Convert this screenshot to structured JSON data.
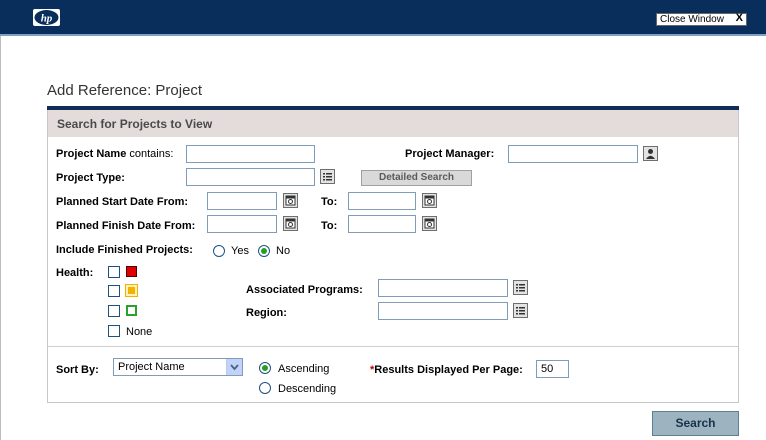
{
  "window": {
    "close_label": "Close Window",
    "close_glyph": "X"
  },
  "page_title": "Add Reference: Project",
  "panel": {
    "title": "Search for Projects to View"
  },
  "form": {
    "project_name": {
      "label_bold": "Project Name",
      "label_rest": " contains:",
      "value": ""
    },
    "project_manager": {
      "label": "Project Manager:",
      "value": ""
    },
    "project_type": {
      "label": "Project Type:",
      "value": ""
    },
    "detailed_search_label": "Detailed Search",
    "planned_start": {
      "label": "Planned Start Date From:",
      "from_value": "",
      "to_label": "To:",
      "to_value": ""
    },
    "planned_finish": {
      "label": "Planned Finish Date From:",
      "from_value": "",
      "to_label": "To:",
      "to_value": ""
    },
    "include_finished": {
      "label": "Include Finished Projects:",
      "yes_label": "Yes",
      "no_label": "No",
      "selected": "No"
    },
    "health": {
      "label": "Health:",
      "options": [
        {
          "color": "#e00000",
          "style": "filled",
          "checked": false
        },
        {
          "color": "#f2b200",
          "style": "bordered",
          "checked": false
        },
        {
          "color": "#2aa22a",
          "style": "outline",
          "checked": false
        }
      ],
      "none_label": "None"
    },
    "associated_programs": {
      "label": "Associated Programs:",
      "value": ""
    },
    "region": {
      "label": "Region:",
      "value": ""
    }
  },
  "sort": {
    "label": "Sort By:",
    "selected": "Project Name",
    "ascending_label": "Ascending",
    "descending_label": "Descending",
    "order_selected": "Ascending"
  },
  "results": {
    "required_mark": "*",
    "label": "Results Displayed Per Page:",
    "value": "50"
  },
  "search_label": "Search",
  "icons": {
    "logo": "hp-logo",
    "user_picker": "user-icon",
    "list_picker": "list-icon",
    "calendar": "calendar-icon",
    "dropdown": "chevron-down-icon"
  }
}
